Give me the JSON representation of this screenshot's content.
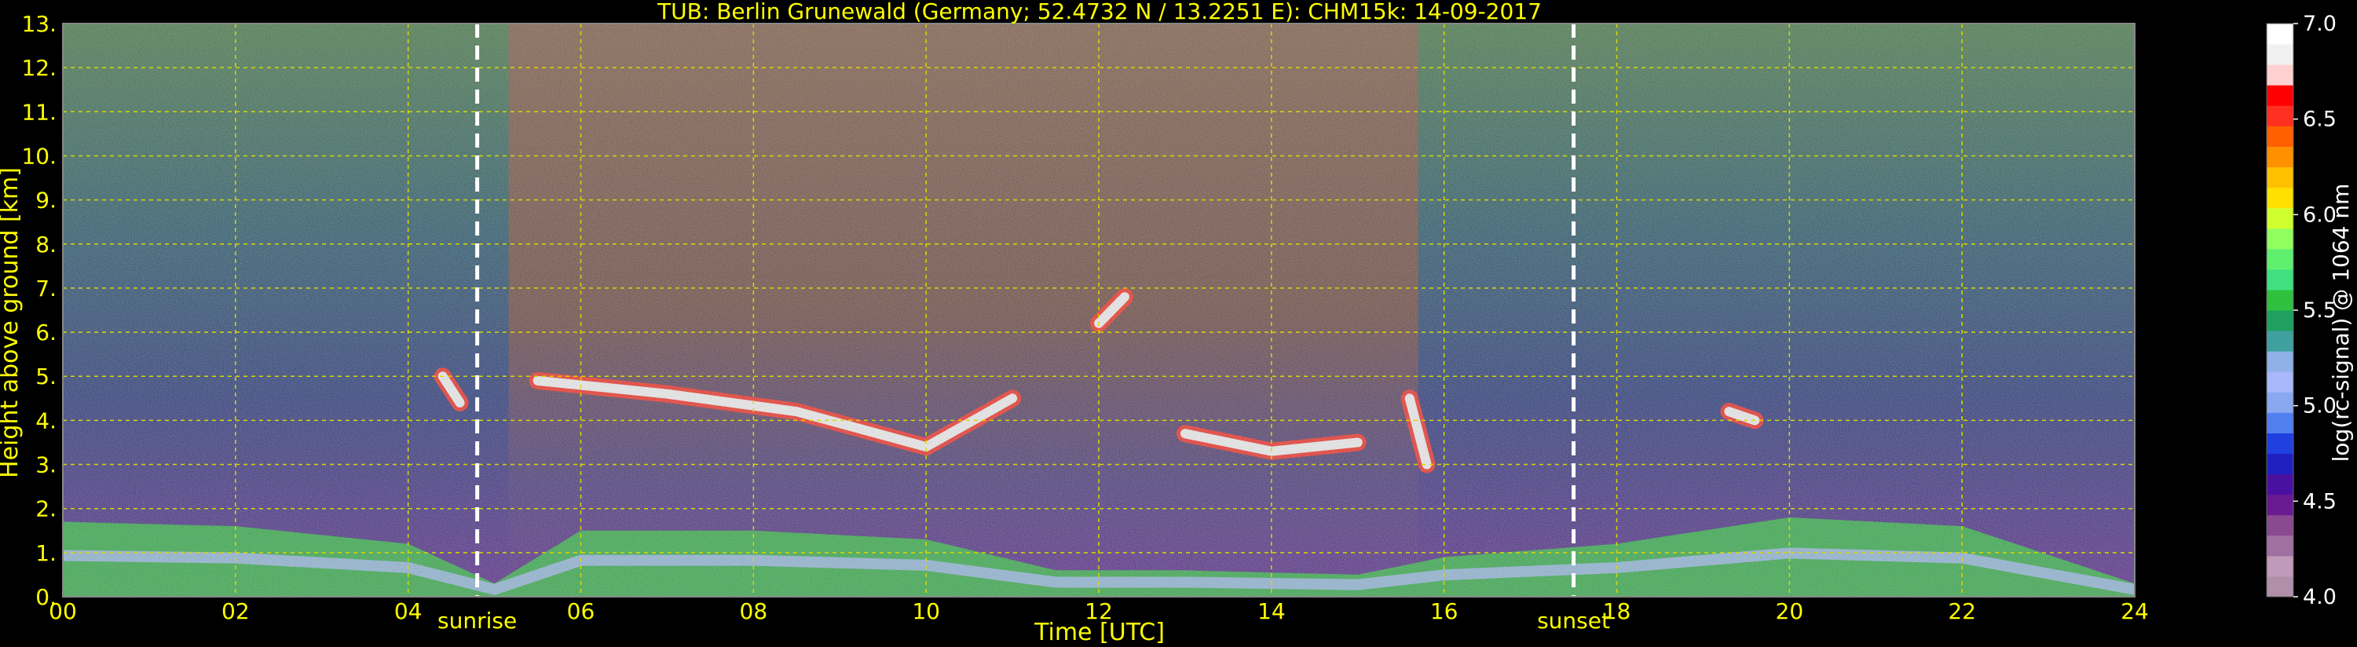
{
  "chart_data": {
    "type": "heatmap",
    "title": "TUB: Berlin Grunewald (Germany; 52.4732 N / 13.2251 E):    CHM15k: 14-09-2017",
    "xlabel": "Time [UTC]",
    "ylabel": "Height above ground [km]",
    "colorbar_label": "log(rc-signal) @ 1064 nm",
    "xlim": [
      0,
      24
    ],
    "ylim": [
      0,
      13
    ],
    "x_ticks": [
      "00",
      "02",
      "04",
      "06",
      "08",
      "10",
      "12",
      "14",
      "16",
      "18",
      "20",
      "22",
      "24"
    ],
    "y_ticks": [
      "0.",
      "1.",
      "2.",
      "3.",
      "4.",
      "5.",
      "6.",
      "7.",
      "8.",
      "9.",
      "10.",
      "11.",
      "12.",
      "13."
    ],
    "colorbar_range": [
      4.0,
      7.0
    ],
    "colorbar_ticks": [
      "4.0",
      "4.5",
      "5.0",
      "5.5",
      "6.0",
      "6.5",
      "7.0"
    ],
    "grid": true,
    "markers": [
      {
        "label": "sunrise",
        "time": 4.8
      },
      {
        "label": "sunset",
        "time": 17.5
      }
    ],
    "layers": [
      {
        "name": "boundary layer",
        "value": 5.6,
        "points": [
          [
            0,
            1.7
          ],
          [
            2,
            1.6
          ],
          [
            4,
            1.2
          ],
          [
            5,
            0.3
          ],
          [
            6,
            1.5
          ],
          [
            8,
            1.5
          ],
          [
            10,
            1.3
          ],
          [
            11.5,
            0.6
          ],
          [
            13,
            0.6
          ],
          [
            15,
            0.5
          ],
          [
            16,
            0.9
          ],
          [
            18,
            1.2
          ],
          [
            20,
            1.8
          ],
          [
            22,
            1.6
          ],
          [
            24,
            0.3
          ]
        ]
      },
      {
        "name": "cloud layer",
        "value": 6.8,
        "points": [
          [
            5.5,
            4.9
          ],
          [
            7,
            4.6
          ],
          [
            8.5,
            4.2
          ],
          [
            10,
            3.4
          ],
          [
            11,
            4.5
          ]
        ]
      },
      {
        "name": "cloud layer",
        "value": 6.8,
        "points": [
          [
            12,
            6.2
          ],
          [
            12.3,
            6.8
          ]
        ]
      },
      {
        "name": "cloud layer",
        "value": 6.8,
        "points": [
          [
            13,
            3.7
          ],
          [
            14,
            3.3
          ],
          [
            15,
            3.5
          ]
        ]
      },
      {
        "name": "cloud layer",
        "value": 6.8,
        "points": [
          [
            15.6,
            4.5
          ],
          [
            15.8,
            3.0
          ]
        ]
      },
      {
        "name": "cloud layer",
        "value": 6.8,
        "points": [
          [
            19.3,
            4.2
          ],
          [
            19.6,
            4.0
          ]
        ]
      },
      {
        "name": "cloud layer",
        "value": 6.8,
        "points": [
          [
            4.4,
            5.0
          ],
          [
            4.6,
            4.4
          ]
        ]
      }
    ]
  },
  "colors": {
    "background": "#000000",
    "text": "#ffff00",
    "grid": "#d8d800",
    "colorbar": [
      "#b090a8",
      "#c09ab8",
      "#a070a0",
      "#8a4a90",
      "#6a1a90",
      "#4a10a0",
      "#2020c0",
      "#2040e0",
      "#5080f0",
      "#8aa8f0",
      "#a8b8f8",
      "#90b0e8",
      "#40a0a0",
      "#20a060",
      "#30c040",
      "#40e080",
      "#60f070",
      "#90ff60",
      "#d0ff30",
      "#ffe000",
      "#ffc000",
      "#ff9000",
      "#ff6000",
      "#ff3020",
      "#ff0000",
      "#ffd0d0",
      "#f0f0f0",
      "#ffffff"
    ]
  }
}
